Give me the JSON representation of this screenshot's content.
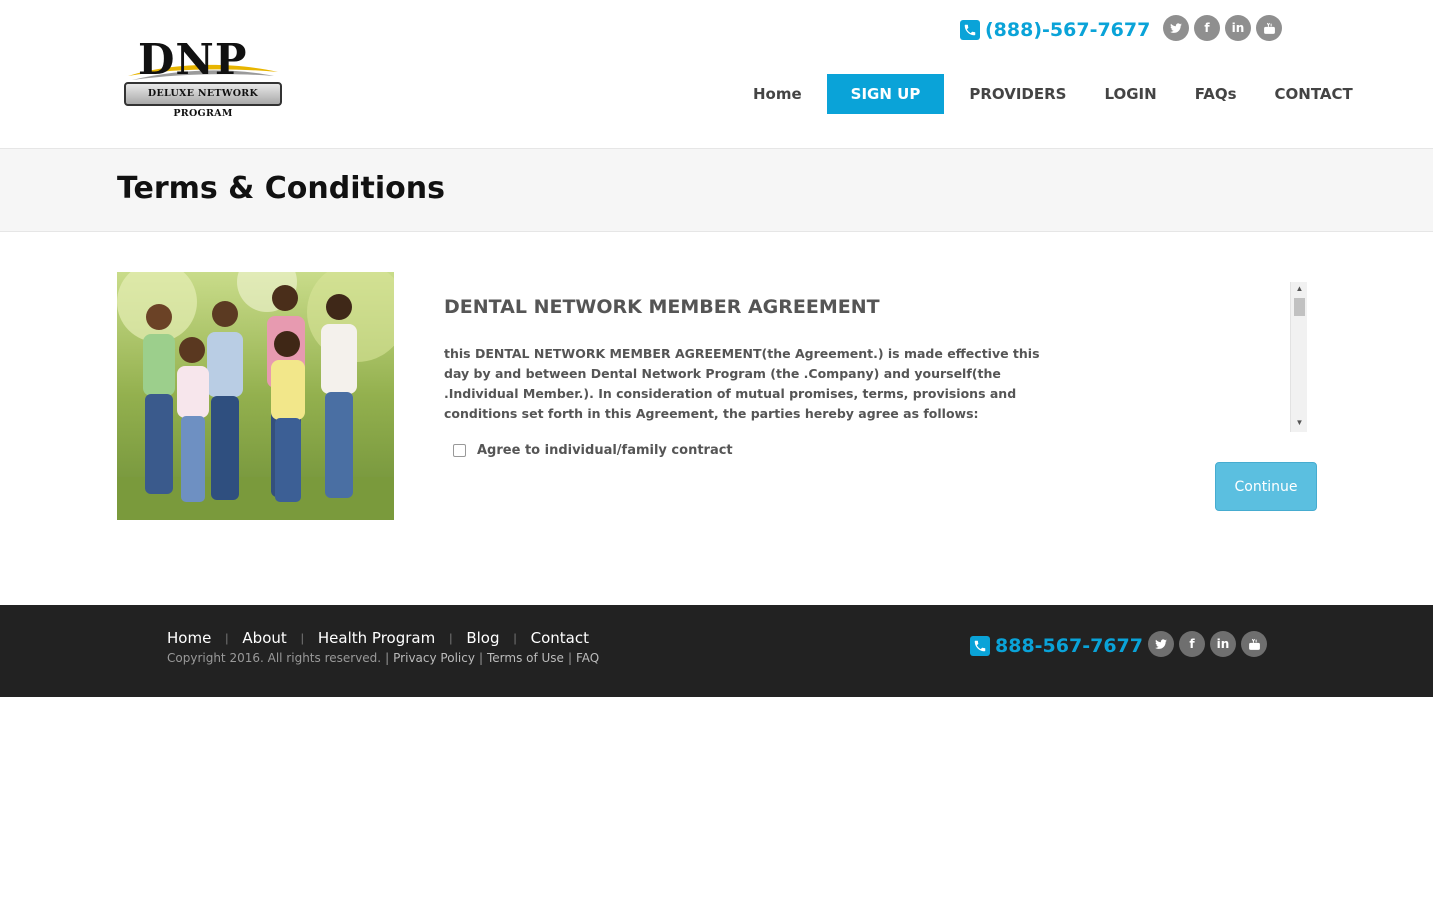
{
  "brand": {
    "logo_letters": "DNP",
    "logo_plate": "DELUXE NETWORK PROGRAM"
  },
  "header": {
    "phone": "(888)-567-7677",
    "social": [
      "twitter-icon",
      "facebook-icon",
      "linkedin-icon",
      "youtube-icon"
    ]
  },
  "nav": {
    "items": [
      {
        "label": "Home",
        "active": false
      },
      {
        "label": "SIGN UP",
        "active": true
      },
      {
        "label": "PROVIDERS",
        "active": false
      },
      {
        "label": "LOGIN",
        "active": false
      },
      {
        "label": "FAQs",
        "active": false
      },
      {
        "label": "CONTACT",
        "active": false
      }
    ]
  },
  "page": {
    "title": "Terms & Conditions"
  },
  "agreement": {
    "title": "DENTAL NETWORK MEMBER AGREEMENT",
    "body": "this DENTAL NETWORK MEMBER AGREEMENT(the Agreement.) is made effective this day by and between Dental Network Program (the .Company) and yourself(the .Individual Member.). In consideration of mutual promises, terms, provisions and conditions set forth in this Agreement, the parties hereby agree as follows:",
    "checkbox_label": "Agree to individual/family contract",
    "checkbox_checked": false,
    "continue_label": "Continue"
  },
  "footer": {
    "links": [
      "Home",
      "About",
      "Health Program",
      "Blog",
      "Contact"
    ],
    "separator": "|",
    "copyright": "Copyright 2016. All rights reserved.",
    "legal_links": [
      "Privacy Policy",
      "Terms of Use",
      "FAQ"
    ],
    "phone": "888-567-7677"
  },
  "colors": {
    "accent": "#0aa3d8",
    "button": "#5bbfe0",
    "footer_bg": "#222222",
    "title_band": "#f6f6f6"
  }
}
